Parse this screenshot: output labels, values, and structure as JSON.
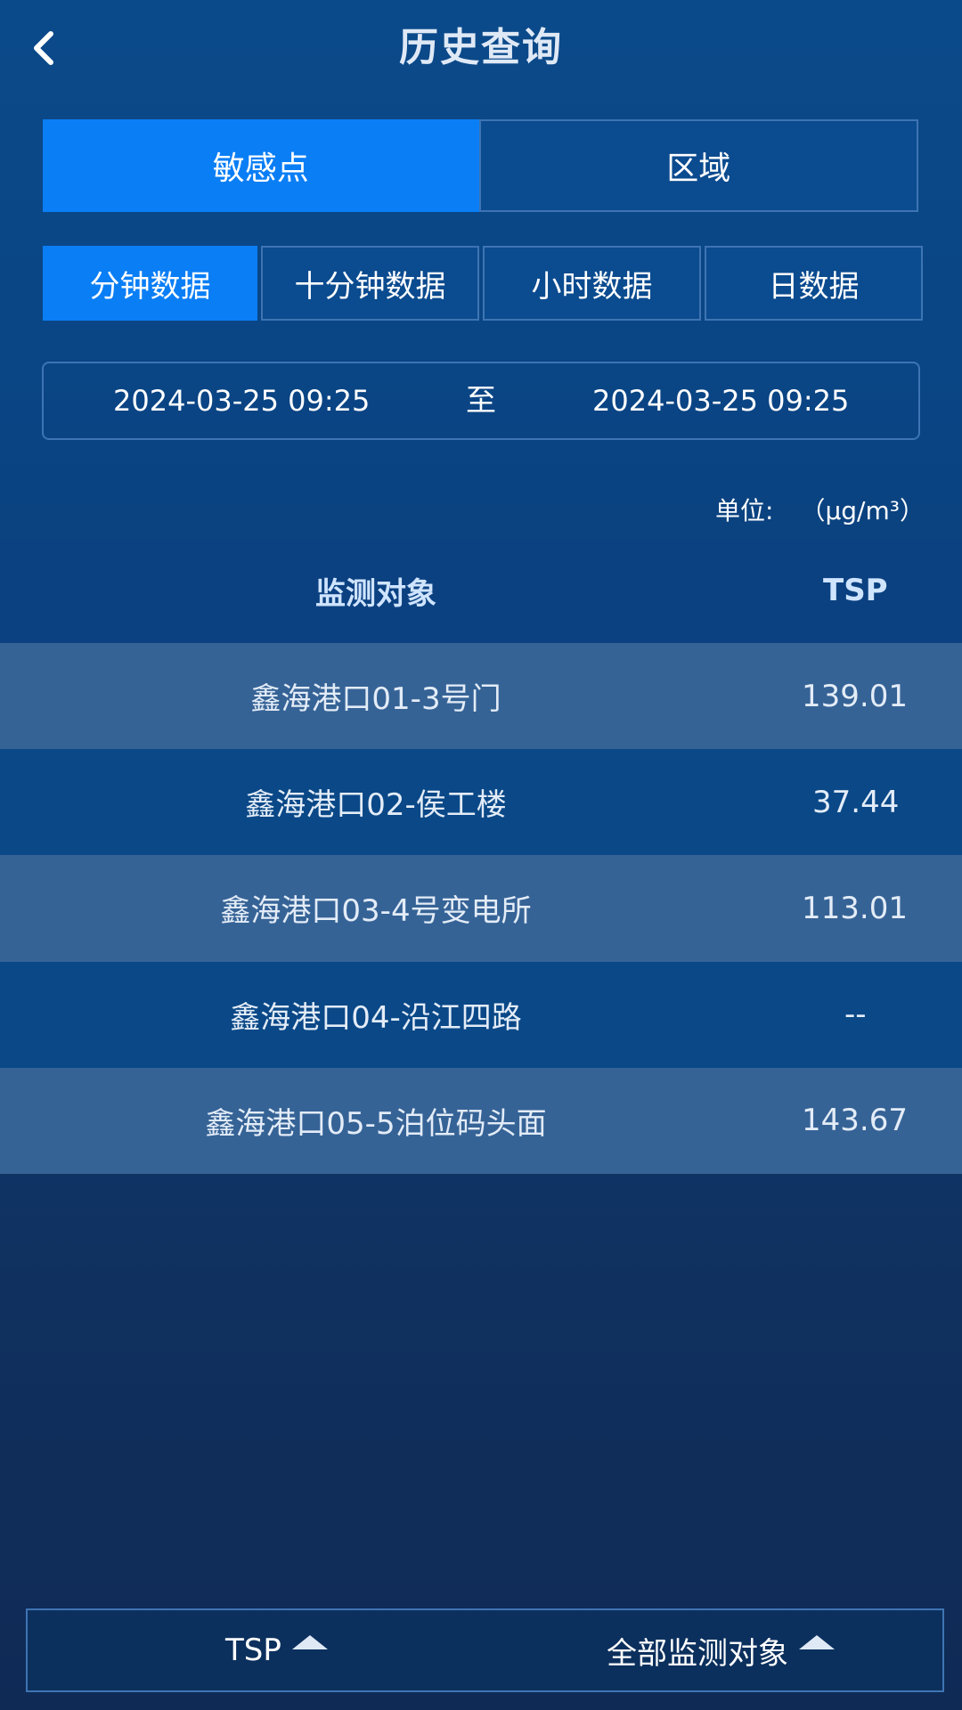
{
  "header": {
    "title": "历史查询"
  },
  "primary_tabs": [
    {
      "label": "敏感点",
      "active": true
    },
    {
      "label": "区域",
      "active": false
    }
  ],
  "period_tabs": [
    {
      "label": "分钟数据",
      "active": true
    },
    {
      "label": "十分钟数据",
      "active": false
    },
    {
      "label": "小时数据",
      "active": false
    },
    {
      "label": "日数据",
      "active": false
    }
  ],
  "date_range": {
    "start": "2024-03-25 09:25",
    "separator": "至",
    "end": "2024-03-25 09:25"
  },
  "unit": {
    "label": "单位:",
    "value": "（μg/m³）"
  },
  "table": {
    "headers": {
      "name": "监测对象",
      "value": "TSP"
    },
    "rows": [
      {
        "name": "鑫海港口01-3号门",
        "value": "139.01"
      },
      {
        "name": "鑫海港口02-侯工楼",
        "value": "37.44"
      },
      {
        "name": "鑫海港口03-4号变电所",
        "value": "113.01"
      },
      {
        "name": "鑫海港口04-沿江四路",
        "value": "--"
      },
      {
        "name": "鑫海港口05-5泊位码头面",
        "value": "143.67"
      }
    ]
  },
  "bottom_bar": {
    "pollutant_filter": "TSP",
    "target_filter": "全部监测对象"
  },
  "colors": {
    "accent": "#0a7ef5",
    "border": "#3e74b3",
    "row_light": "#366396",
    "row_dark": "#0a4887"
  },
  "icons": {
    "back": "chevron-left-icon",
    "dropdown": "caret-up-icon"
  }
}
